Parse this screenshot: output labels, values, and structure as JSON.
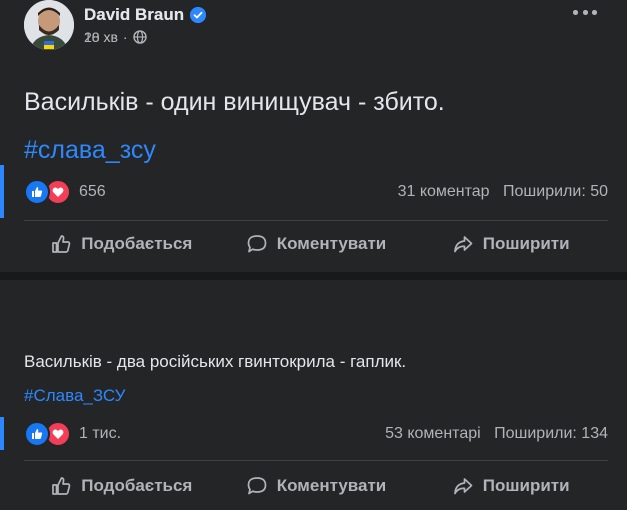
{
  "posts": [
    {
      "author": "David Braun",
      "time": "18 хв",
      "text": "Васильків - один винищувач - збито.",
      "hashtag": "#слава_зсу",
      "reactions_count": "656",
      "comments": "31 коментар",
      "shares": "Поширили: 50"
    },
    {
      "author": "David Braun",
      "time": "20 хв",
      "text": "Васильків - два російських гвинтокрила - гаплик.",
      "hashtag": "#Слава_ЗСУ",
      "reactions_count": "1 тис.",
      "comments": "53 коментарі",
      "shares": "Поширили: 134"
    }
  ],
  "actions": {
    "like": "Подобається",
    "comment": "Коментувати",
    "share": "Поширити"
  },
  "icons": {
    "verified": "verified-badge-icon",
    "privacy": "globe-icon",
    "more": "more-options-icon",
    "like_reaction": "like-reaction-icon",
    "love_reaction": "love-reaction-icon",
    "like_action": "thumbs-up-icon",
    "comment_action": "comment-bubble-icon",
    "share_action": "share-arrow-icon"
  },
  "colors": {
    "background": "#18191a",
    "card": "#242526",
    "text": "#e4e6eb",
    "secondary": "#b0b3b8",
    "link": "#2d88ff",
    "like": "#1877f2",
    "love": "#f33e58"
  }
}
